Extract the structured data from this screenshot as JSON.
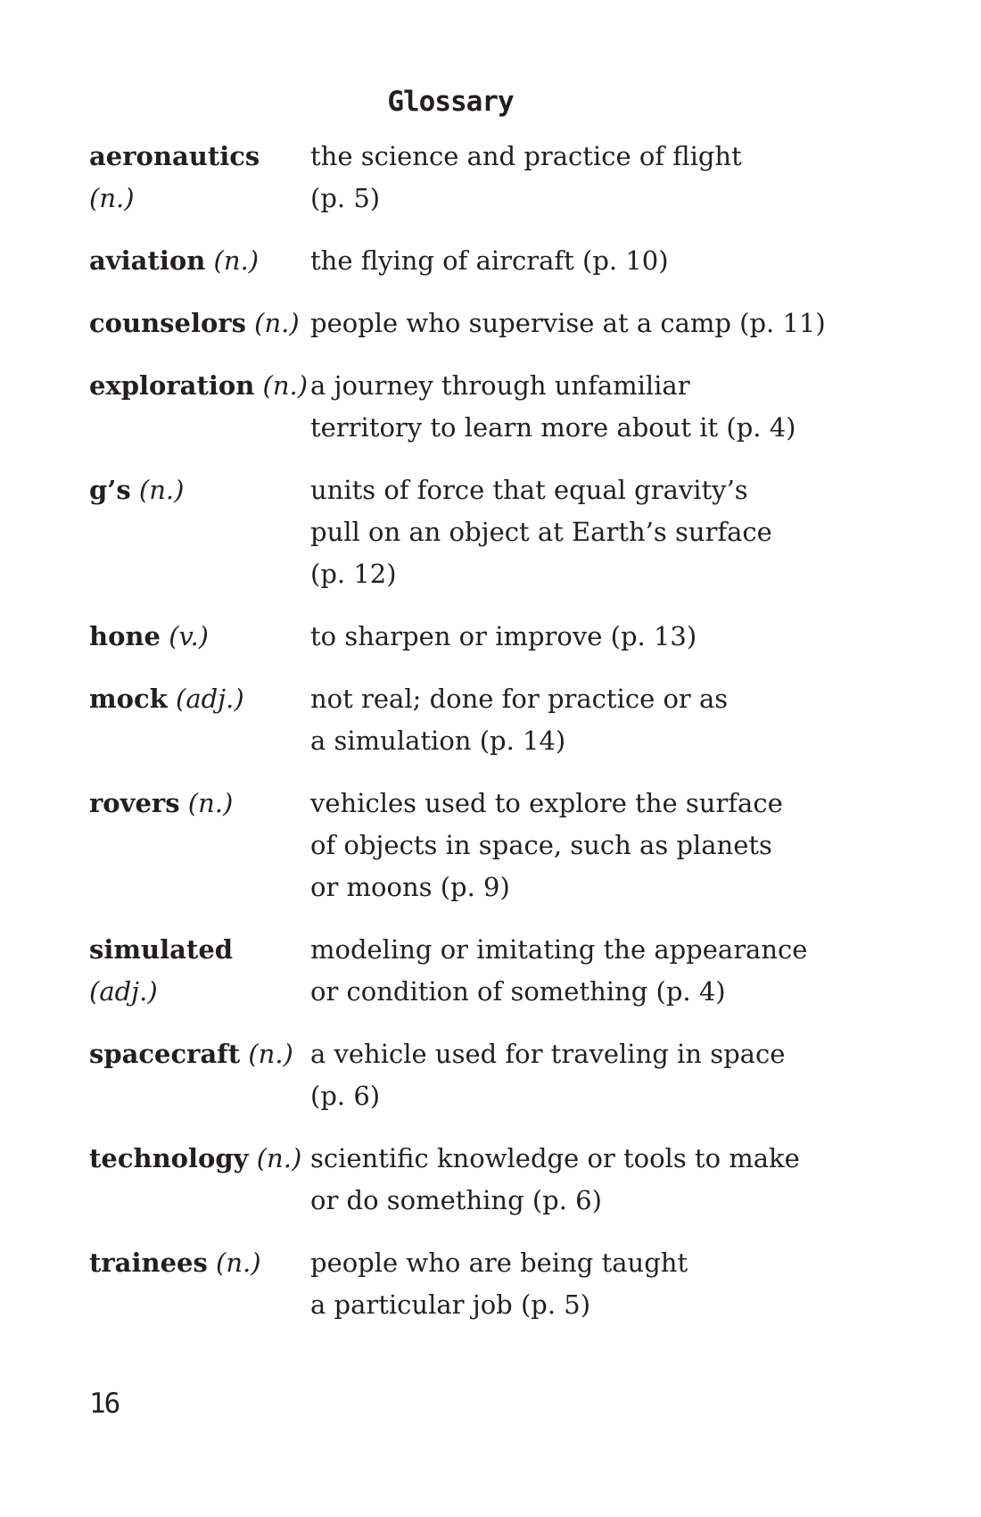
{
  "title": "Glossary",
  "entries": [
    {
      "term": "aeronautics",
      "pos": "(n.)",
      "definition": [
        "the science and practice of flight",
        "(p. 5)"
      ]
    },
    {
      "term": "aviation",
      "pos": "(n.)",
      "definition": [
        "the flying of aircraft (p. 10)"
      ]
    },
    {
      "term": "counselors",
      "pos": "(n.)",
      "definition": [
        "people who supervise at a camp (p. 11)"
      ]
    },
    {
      "term": "exploration",
      "pos": "(n.)",
      "definition": [
        "a journey through unfamiliar",
        "territory to learn more about it (p. 4)"
      ]
    },
    {
      "term": "g’s",
      "pos": "(n.)",
      "definition": [
        "units of force that equal gravity’s",
        "pull on an object at Earth’s surface",
        "(p. 12)"
      ]
    },
    {
      "term": "hone",
      "pos": "(v.)",
      "definition": [
        "to sharpen or improve (p. 13)"
      ]
    },
    {
      "term": "mock",
      "pos": "(adj.)",
      "definition": [
        "not real; done for practice or as",
        "a simulation (p. 14)"
      ]
    },
    {
      "term": "rovers",
      "pos": "(n.)",
      "definition": [
        "vehicles used to explore the surface",
        "of objects in space, such as planets",
        "or moons (p. 9)"
      ]
    },
    {
      "term": "simulated",
      "pos": "(adj.)",
      "definition": [
        "modeling or imitating the appearance",
        "or condition of something (p. 4)"
      ],
      "pos_on_new_line": true
    },
    {
      "term": "spacecraft",
      "pos": "(n.)",
      "definition": [
        "a vehicle used for traveling in space",
        "(p. 6)"
      ]
    },
    {
      "term": "technology",
      "pos": "(n.)",
      "definition": [
        "scientific knowledge or tools to make",
        "or do something (p. 6)"
      ]
    },
    {
      "term": "trainees",
      "pos": "(n.)",
      "definition": [
        "people who are being taught",
        "a particular job (p. 5)"
      ]
    }
  ],
  "page_number": "16"
}
